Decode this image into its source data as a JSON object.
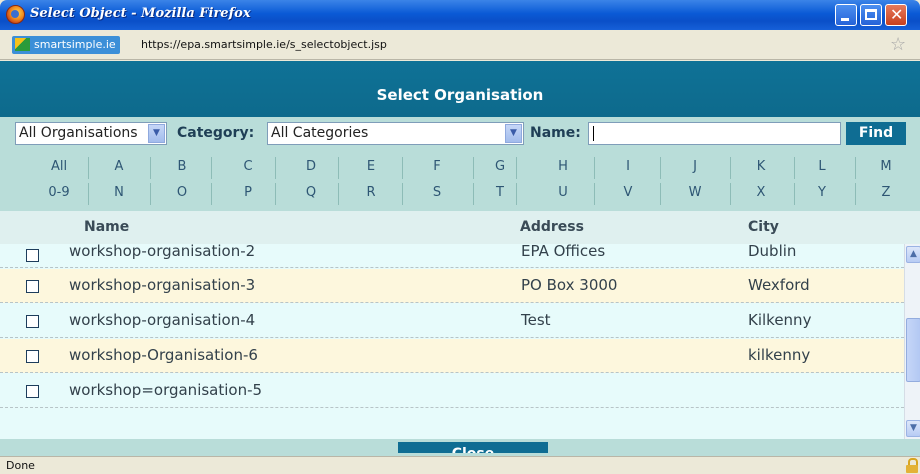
{
  "window": {
    "title": "Select Object - Mozilla Firefox"
  },
  "address_bar": {
    "site_badge": "smartsimple.ie",
    "url": "https://epa.smartsimple.ie/s_selectobject.jsp"
  },
  "header": {
    "title": "Select Organisation"
  },
  "filters": {
    "organisation_select": "All Organisations",
    "category_label": "Category:",
    "category_select": "All Categories",
    "name_label": "Name:",
    "name_value": "",
    "find_label": "Find"
  },
  "alphabet": {
    "row1": [
      "All",
      "A",
      "B",
      "C",
      "D",
      "E",
      "F",
      "G",
      "H",
      "I",
      "J",
      "K",
      "L",
      "M"
    ],
    "row2": [
      "0-9",
      "N",
      "O",
      "P",
      "Q",
      "R",
      "S",
      "T",
      "U",
      "V",
      "W",
      "X",
      "Y",
      "Z"
    ]
  },
  "table": {
    "columns": {
      "name": "Name",
      "address": "Address",
      "city": "City"
    },
    "rows": [
      {
        "name": "workshop-organisation-2",
        "address": "EPA Offices",
        "city": "Dublin"
      },
      {
        "name": "workshop-organisation-3",
        "address": "PO Box 3000",
        "city": "Wexford"
      },
      {
        "name": "workshop-organisation-4",
        "address": "Test",
        "city": "Kilkenny"
      },
      {
        "name": "workshop-Organisation-6",
        "address": "",
        "city": "kilkenny"
      },
      {
        "name": "workshop=organisation-5",
        "address": "",
        "city": ""
      }
    ]
  },
  "footer": {
    "close_label": "Close"
  },
  "status": {
    "text": "Done"
  },
  "colors": {
    "header": "#0f7297",
    "panel": "#b9ddd9",
    "button": "#0f6d93",
    "row_alt": "#fdf7dd"
  }
}
